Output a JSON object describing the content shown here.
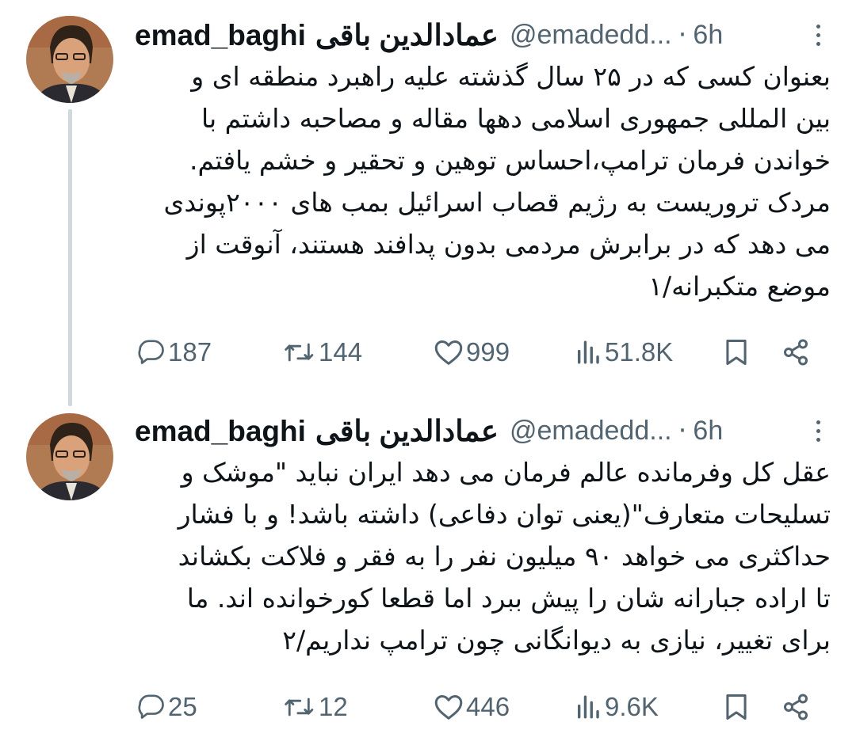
{
  "tweets": [
    {
      "author_name_latin": "emad_baghi",
      "author_name_persian": "عمادالدین باقی",
      "handle": "@emadedd...",
      "separator": "·",
      "time": "6h",
      "lines": [
        "بعنوان کسی که در ۲۵ سال گذشته علیه راهبرد منطقه ای و",
        "بین المللی جمهوری اسلامی دهها مقاله و مصاحبه داشتم با",
        "خواندن فرمان ترامپ،احساس توهین و تحقیر و خشم یافتم.",
        "مردک تروریست به رژیم قصاب اسرائیل بمب های ۲۰۰۰پوندی",
        "می دهد که در برابرش مردمی بدون پدافند هستند، آنوقت از",
        "موضع متکبرانه/۱"
      ],
      "replies": "187",
      "retweets": "144",
      "likes": "999",
      "views": "51.8K"
    },
    {
      "author_name_latin": "emad_baghi",
      "author_name_persian": "عمادالدین باقی",
      "handle": "@emadedd...",
      "separator": "·",
      "time": "6h",
      "lines": [
        "عقل کل وفرمانده عالم فرمان می دهد ایران نباید \"موشک و",
        "تسلیحات متعارف\"(یعنی توان دفاعی) داشته باشد! و با فشار",
        "حداکثری می خواهد ۹۰ میلیون نفر را به فقر و فلاکت بکشاند",
        "تا اراده جبارانه شان را پیش ببرد اما قطعا کورخوانده اند. ما",
        "برای تغییر، نیازی به دیوانگانی چون ترامپ نداریم/۲"
      ],
      "replies": "25",
      "retweets": "12",
      "likes": "446",
      "views": "9.6K"
    }
  ],
  "icons": {
    "reply": "reply-icon",
    "retweet": "retweet-icon",
    "like": "heart-icon",
    "views": "views-icon",
    "bookmark": "bookmark-icon",
    "share": "share-icon",
    "more": "more-options-icon"
  },
  "colors": {
    "text": "#0f1419",
    "secondary": "#536471",
    "thread_line": "#cfd9de",
    "background": "#ffffff"
  }
}
